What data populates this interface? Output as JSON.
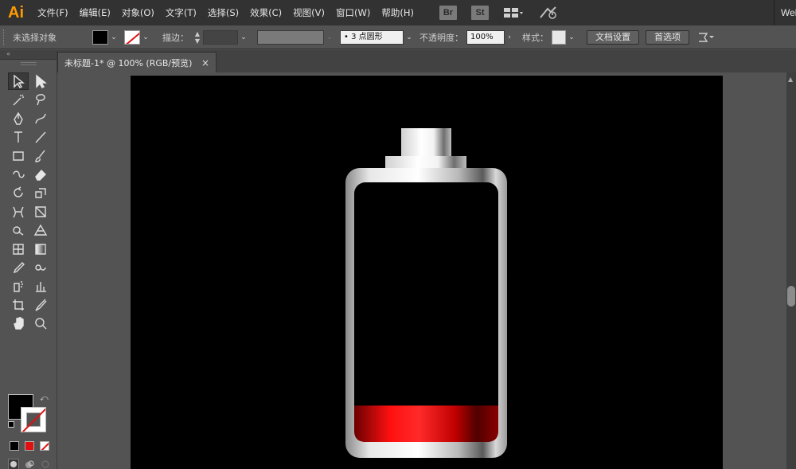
{
  "app": {
    "logo": "Ai",
    "workspace": "Web"
  },
  "menu": [
    "文件(F)",
    "编辑(E)",
    "对象(O)",
    "文字(T)",
    "选择(S)",
    "效果(C)",
    "视图(V)",
    "窗口(W)",
    "帮助(H)"
  ],
  "badges": [
    "Br",
    "St"
  ],
  "controlbar": {
    "selection_label": "未选择对象",
    "stroke_label": "描边：",
    "brush_value": "• 3 点圆形",
    "opacity_label": "不透明度：",
    "opacity_value": "100%",
    "style_label": "样式：",
    "doc_setup_button": "文档设置",
    "prefs_button": "首选项"
  },
  "document": {
    "tab_title": "未标题-1* @ 100% (RGB/预览)",
    "close_glyph": "×"
  },
  "artwork": {
    "battery_fill_level": 0.14,
    "fill_color": "#ff0000",
    "background": "#000000"
  }
}
